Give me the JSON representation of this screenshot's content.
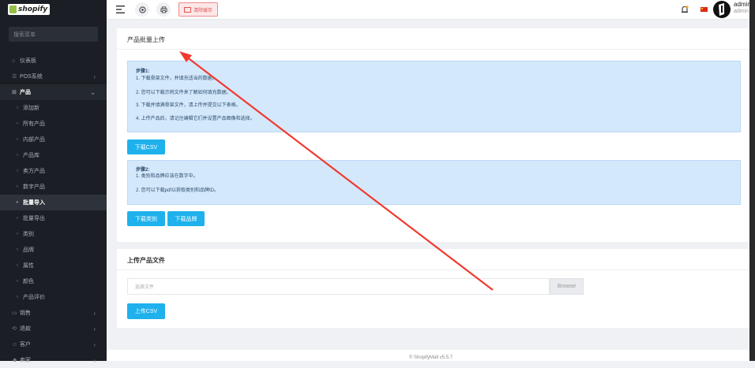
{
  "sidebar": {
    "logo_text": "shopify",
    "search_placeholder": "搜索菜单",
    "items": [
      {
        "icon": "home-icon",
        "glyph": "⌂",
        "label": "仪表板"
      },
      {
        "icon": "pos-icon",
        "glyph": "☰",
        "label": "POS系统",
        "chevron": "›"
      },
      {
        "icon": "product-icon",
        "glyph": "⊠",
        "label": "产品",
        "chevron": "⌄"
      }
    ],
    "sub_items": [
      "添加新",
      "所有产品",
      "内部产品",
      "产品库",
      "卖方产品",
      "数字产品",
      "批量导入",
      "批量导出",
      "类别",
      "品牌",
      "属性",
      "颜色",
      "产品评价"
    ],
    "bottom_items": [
      {
        "icon": "sales-icon",
        "glyph": "▭",
        "label": "销售",
        "chevron": "›"
      },
      {
        "icon": "refund-icon",
        "glyph": "⟲",
        "label": "退款",
        "chevron": "›"
      },
      {
        "icon": "customer-icon",
        "glyph": "☺",
        "label": "客户",
        "chevron": "›"
      },
      {
        "icon": "seller-icon",
        "glyph": "☻",
        "label": "卖家",
        "chevron": "›"
      }
    ]
  },
  "topbar": {
    "clear_cache": "清除缓存",
    "admin_name": "admin",
    "admin_role": "admin"
  },
  "main": {
    "title": "产品批量上传",
    "steps1_title": "步骤1:",
    "steps1": [
      "1. 下载骨架文件，并填充适当的数据。",
      "2. 您可以下载示例文件来了解如何填充数据。",
      "3. 下载并填满骨架文件，请上传并提交以下表格。",
      "4. 上传产品后，请记住编辑它们并设置产品图像和选择。"
    ],
    "download_csv": "下载CSV",
    "steps2_title": "步骤2:",
    "steps2": [
      "1. 类别和品牌应该在数字中。",
      "2. 您可以下载pdf以获取类别和品牌ID。"
    ],
    "download_category": "下载类别",
    "download_brand": "下载品牌",
    "upload_title": "上传产品文件",
    "file_placeholder": "选择文件",
    "browse": "Browse",
    "upload_csv": "上传CSV"
  },
  "footer": "© ShopifyMall v5.5.7",
  "colors": {
    "accent": "#1fb1ec",
    "info_bg": "#d4e8fb",
    "sidebar_bg": "#1b1e24",
    "arrow": "#f03a2e"
  }
}
